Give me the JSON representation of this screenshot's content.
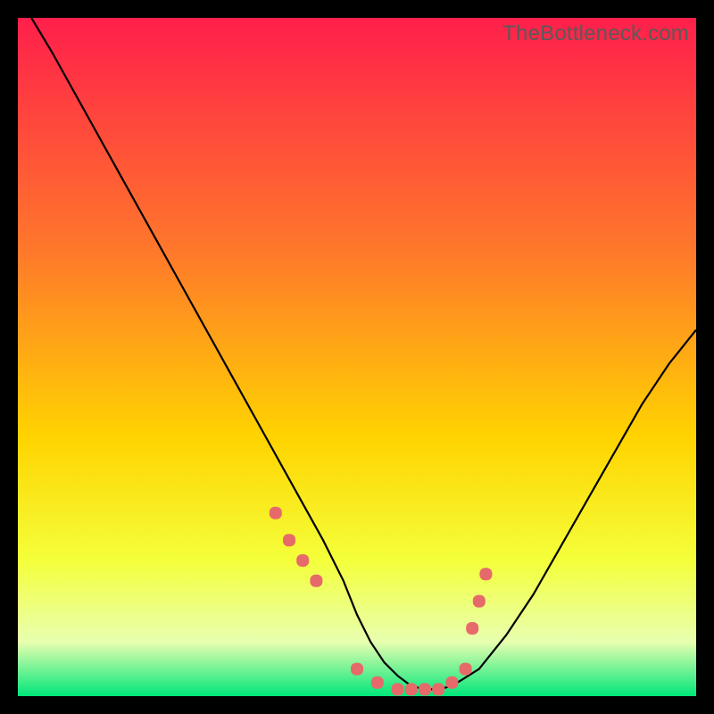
{
  "watermark": "TheBottleneck.com",
  "colors": {
    "grad_top": "#ff1f4b",
    "grad_mid1": "#ff7a2a",
    "grad_mid2": "#ffd400",
    "grad_mid3": "#f4ff3a",
    "grad_low": "#e8ffb0",
    "grad_bottom": "#00e67a",
    "curve": "#000000",
    "markers": "#e66a6a",
    "frame": "#000000"
  },
  "chart_data": {
    "type": "line",
    "title": "",
    "xlabel": "",
    "ylabel": "",
    "xlim": [
      0,
      100
    ],
    "ylim": [
      0,
      100
    ],
    "x": [
      2,
      5,
      10,
      15,
      20,
      25,
      30,
      35,
      40,
      45,
      48,
      50,
      52,
      54,
      56,
      58,
      60,
      62,
      64,
      68,
      72,
      76,
      80,
      84,
      88,
      92,
      96,
      100
    ],
    "values": [
      100,
      95,
      86,
      77,
      68,
      59,
      50,
      41,
      32,
      23,
      17,
      12,
      8,
      5,
      3,
      1.5,
      1,
      1,
      1.5,
      4,
      9,
      15,
      22,
      29,
      36,
      43,
      49,
      54
    ],
    "markers_x": [
      38,
      40,
      42,
      44,
      50,
      53,
      56,
      58,
      60,
      62,
      64,
      66,
      67,
      68,
      69
    ],
    "markers_y": [
      27,
      23,
      20,
      17,
      4,
      2,
      1,
      1,
      1,
      1,
      2,
      4,
      10,
      14,
      18
    ]
  }
}
